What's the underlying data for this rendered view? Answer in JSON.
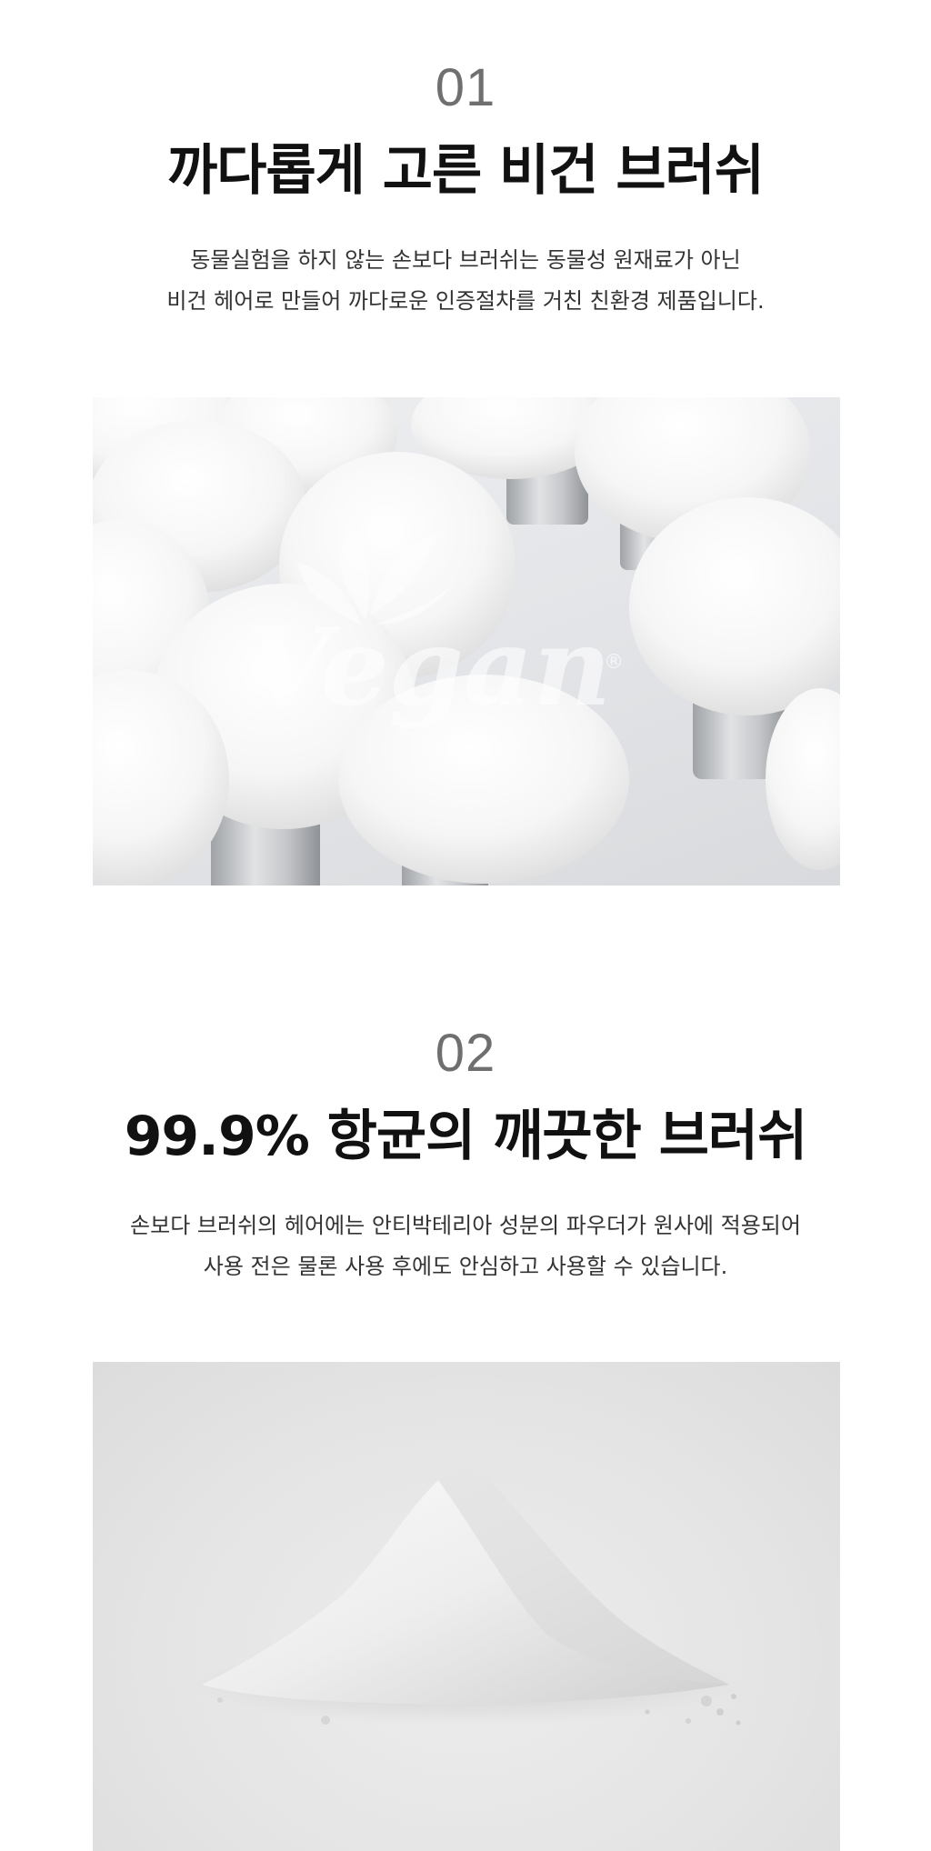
{
  "sections": [
    {
      "number": "01",
      "title": "까다롭게 고른 비건 브러쉬",
      "description_lines": [
        "동물실험을 하지 않는 손보다 브러쉬는 동물성 원재료가 아닌",
        "비건 헤어로 만들어 까다로운 인증절차를 거친 친환경 제품입니다."
      ],
      "image": {
        "subject": "white vegan kabuki brushes",
        "watermark": "Vegan",
        "watermark_mark": "®"
      }
    },
    {
      "number": "02",
      "title": "99.9% 항균의 깨끗한 브러쉬",
      "description_lines": [
        "손보다 브러쉬의 헤어에는 안티박테리아 성분의 파우더가 원사에 적용되어",
        "사용 전은 물론 사용 후에도 안심하고 사용할 수 있습니다."
      ],
      "image": {
        "subject": "pile of white antibacterial powder"
      }
    }
  ],
  "colors": {
    "number": "#6f6f6f",
    "title": "#111111",
    "description": "#333333",
    "background": "#ffffff"
  }
}
